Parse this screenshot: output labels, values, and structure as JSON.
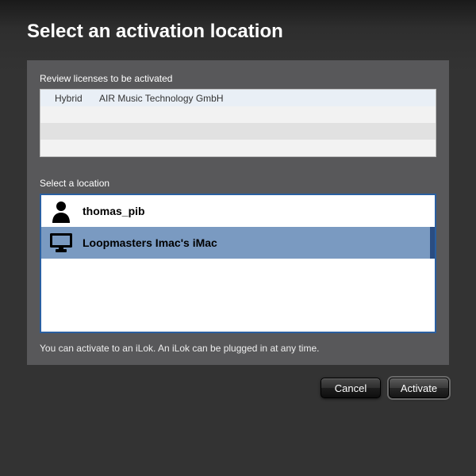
{
  "dialog": {
    "title": "Select an activation location"
  },
  "licenses": {
    "section_label": "Review licenses to be activated",
    "rows": [
      {
        "product": "Hybrid",
        "vendor": "AIR Music Technology GmbH"
      }
    ]
  },
  "locations": {
    "section_label": "Select a location",
    "items": [
      {
        "icon": "user-icon",
        "label": "thomas_pib",
        "selected": false
      },
      {
        "icon": "computer-icon",
        "label": "Loopmasters Imac's iMac",
        "selected": true
      }
    ],
    "hint": "You can activate to an iLok. An iLok can be plugged in at any time."
  },
  "buttons": {
    "cancel": "Cancel",
    "activate": "Activate"
  }
}
